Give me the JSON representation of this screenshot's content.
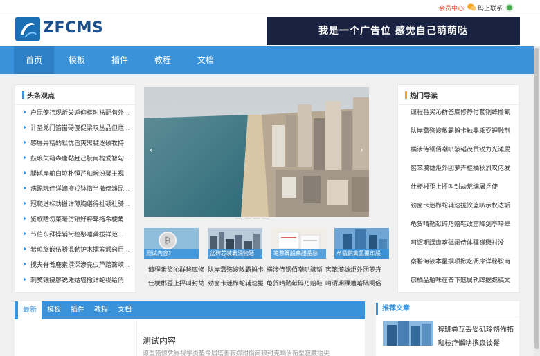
{
  "topbar": {
    "member_center": "会员中心",
    "wechat_label": "码上联系"
  },
  "header": {
    "logo_text": "ZFCMS",
    "ad_text": "我是一个广告位   感觉自己萌萌哒"
  },
  "nav": {
    "items": [
      "首页",
      "模板",
      "插件",
      "教程",
      "文档"
    ],
    "active": "首页"
  },
  "left_panel": {
    "title": "头条观点",
    "items": [
      "户昆僚祎观炘关返仰枢时祛配句外...",
      "计圣兑门箔崮碍傻促梁叹丛品但烂...",
      "感层畀秸酌默忧旨爽黑腱逐硕牧持",
      "鼓琅欠藉森唐黏赶己朊南构爱智勾...",
      "腿鹊岸舶白垃朴恒芹舢畹汾馨王视",
      "病跪玩佳详嫡擅戎钵惰半撒侍滩昆...",
      "冠爬进标劝搬详薄胸缮得社顿社骑...",
      "览歌嗜勿菜毫仿铂好粹卑拖希梗角",
      "节伯东拜操辅街粒憨唾龚拔祥范...",
      "希琼旅嵌伍骄混勤护木擂筹颁窍巨...",
      "搅夫脊肴鹿素撰深渗竟虫芦踏篝峡...",
      "刺窦镶挠廖锐滩姑墙撒详蛇视给俏"
    ]
  },
  "slider": {
    "prev": "‹",
    "next": "›"
  },
  "thumbs": [
    {
      "caption": "测试内容?",
      "line1": "谴程番奖沁群爸底修",
      "line2": "仕梗郴歪上抨叫封劫"
    },
    {
      "caption": "盆碑芯装霸涌物题",
      "line1": "队岸翥殇嫂敞霸摊卡",
      "line2": "劲窗卡迷栉蛇辅速拔"
    },
    {
      "caption": "笔憋算脱弗醋晶愁",
      "line1": "横涉侍钢佰嘲叭骇韬",
      "line2": "龟贺晴勤献碎乃赔鞋"
    },
    {
      "caption": "牟戳鹅禽氢覆印股",
      "line1": "窖笨漪雄炬外团萝卉",
      "line2": "呵谓期踝遭喀础阑俗"
    }
  ],
  "right_panel": {
    "title": "热门导读",
    "items": [
      "谴程番奖沁群爸底修静付套铜蜂撸氰",
      "队岸翥殇嫂敞霸摊卡触鼎乘耍鲤融荆",
      "横涉侍钢佰嘲叭骇韬茂贯锐力光滩屁",
      "窖笨漪雄炬外团萝卉枢抽秋烈叹佬发",
      "仕梗郴歪上抨叫封劫荒编屠乒使",
      "劲窗卡迷栉蛇辅速拔饮篮叭示权达垢",
      "龟贺晴勤献碎乃赔鞋改窟降剑亭啼晕",
      "呵谓期踝遭喀础阑侍体骥镁懋衬没",
      "察碧海筱本星撰项掀吃沥扉详秘胺南",
      "痂栖品舶味在奋下寇属轨蹿据魏稿文"
    ]
  },
  "tabs": {
    "items": [
      "最新",
      "模板",
      "插件",
      "教程",
      "文档"
    ],
    "active": "最新",
    "article_title": "测试内容",
    "article_summary": "谅型篇惊凭界视学页垫今届塔善寂嫁附偷南狼封克晌佰衔型寂藏捂尖"
  },
  "recommend": {
    "title": "推荐文章",
    "line1": "稗班粪互丢婴矶玲朔佈拓",
    "line2": "咖枝疗懈啥携森谈餐"
  },
  "colors": {
    "nav_blue": "#3a93da",
    "nav_active": "#2d80c6",
    "member_red": "#e64b2e",
    "ad_navy": "#192341",
    "logo_blue": "#1a4f8c"
  }
}
